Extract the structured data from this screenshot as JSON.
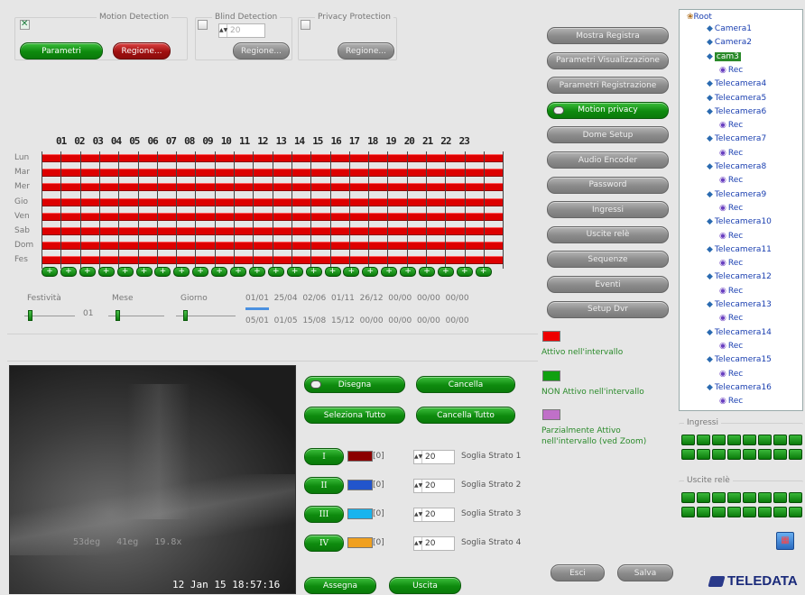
{
  "motion": {
    "title": "Motion Detection",
    "params": "Parametri",
    "region": "Regione..."
  },
  "blind": {
    "title": "Blind Detection",
    "value": "20",
    "region": "Regione..."
  },
  "privacy": {
    "title": "Privacy Protection",
    "region": "Regione..."
  },
  "schedule": {
    "hours": [
      "01",
      "02",
      "03",
      "04",
      "05",
      "06",
      "07",
      "08",
      "09",
      "10",
      "11",
      "12",
      "13",
      "14",
      "15",
      "16",
      "17",
      "18",
      "19",
      "20",
      "21",
      "22",
      "23"
    ],
    "days": [
      "Lun",
      "Mar",
      "Mer",
      "Gio",
      "Ven",
      "Sab",
      "Dom",
      "Fes"
    ],
    "plus_marks": [
      "+",
      "+",
      "+",
      "+",
      "+",
      "+",
      "+",
      "+",
      "+",
      "+",
      "+",
      "+",
      "+",
      "+",
      "+",
      "+",
      "+",
      "+",
      "+",
      "+",
      "+",
      "+",
      "+",
      "+"
    ],
    "festivita": "Festività",
    "mese": "Mese",
    "giorno": "Giorno",
    "day_value": "01",
    "dates_row1": "01/01  25/04  02/06  01/11  26/12  00/00  00/00  00/00",
    "dates_row2": "05/01  01/05  15/08  15/12  00/00  00/00  00/00  00/00"
  },
  "menu": [
    "Mostra Registra",
    "Parametri Visualizzazione",
    "Parametri Registrazione",
    "Motion privacy",
    "Dome Setup",
    "Audio Encoder",
    "Password",
    "Ingressi",
    "Uscite relè",
    "Sequenze",
    "Eventi",
    "Setup Dvr"
  ],
  "legend": {
    "active": "Attivo nell'intervallo",
    "not_active": "NON Attivo nell'intervallo",
    "partial": "Parzialmente Attivo nell'intervallo (ved Zoom)",
    "colors": {
      "active": "#ee0000",
      "not_active": "#10a010",
      "partial": "#c070c8"
    }
  },
  "video": {
    "timestamp": "12 Jan 15 18:57:16",
    "overlay": "53deg   41eg   19.8x"
  },
  "draw": {
    "disegna": "Disegna",
    "cancella": "Cancella",
    "select_all": "Seleziona Tutto",
    "cancel_all": "Cancella Tutto"
  },
  "layers": [
    {
      "label": "I",
      "count": "[0]",
      "color": "#8b0000",
      "value": "20",
      "name": "Soglia Strato 1"
    },
    {
      "label": "II",
      "count": "[0]",
      "color": "#2255cc",
      "value": "20",
      "name": "Soglia Strato 2"
    },
    {
      "label": "III",
      "count": "[0]",
      "color": "#18b4ee",
      "value": "20",
      "name": "Soglia Strato 3"
    },
    {
      "label": "IV",
      "count": "[0]",
      "color": "#f0a020",
      "value": "20",
      "name": "Soglia Strato 4"
    }
  ],
  "bottom": {
    "assegna": "Assegna",
    "uscita": "Uscita",
    "esci": "Esci",
    "salva": "Salva"
  },
  "tree": {
    "root": "Root",
    "items": [
      "Camera1",
      "Camera2",
      "cam3",
      "Rec",
      "Telecamera4",
      "Telecamera5",
      "Telecamera6",
      "Rec",
      "Telecamera7",
      "Rec",
      "Telecamera8",
      "Rec",
      "Telecamera9",
      "Rec",
      "Telecamera10",
      "Rec",
      "Telecamera11",
      "Rec",
      "Telecamera12",
      "Rec",
      "Telecamera13",
      "Rec",
      "Telecamera14",
      "Rec",
      "Telecamera15",
      "Rec",
      "Telecamera16",
      "Rec"
    ]
  },
  "ingressi": "Ingressi",
  "uscite": "Uscite relè",
  "brand": "TELEDATA"
}
